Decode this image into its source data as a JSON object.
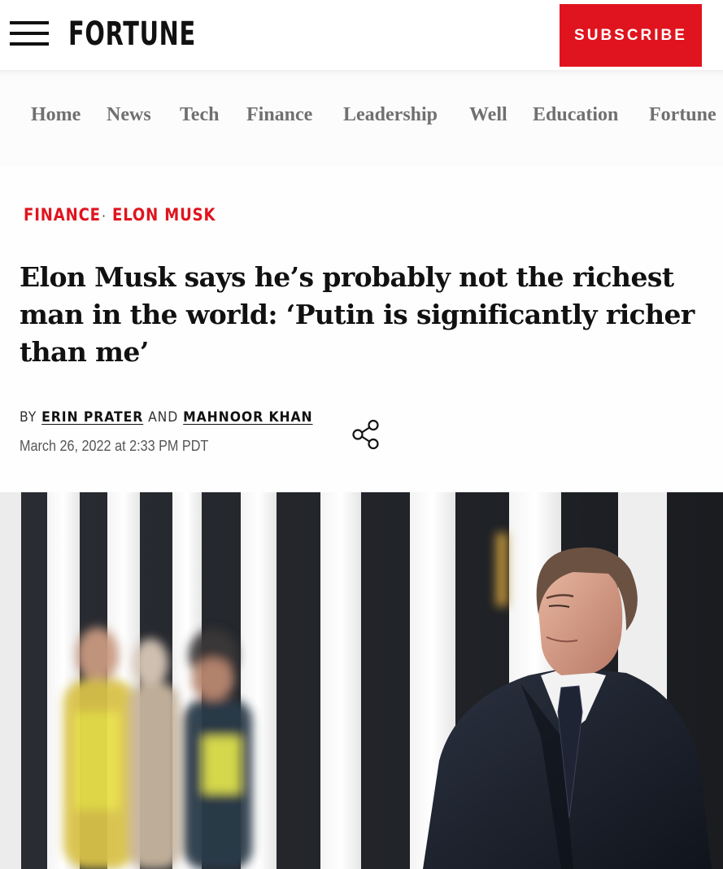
{
  "header": {
    "logo_text": "FORTUNE",
    "subscribe_label": "SUBSCRIBE",
    "brand_color": "#e0141e"
  },
  "nav": {
    "items": [
      "Home",
      "News",
      "Tech",
      "Finance",
      "Leadership",
      "Well",
      "Education",
      "Fortune"
    ]
  },
  "article": {
    "categories": [
      "FINANCE",
      "ELON MUSK"
    ],
    "category_separator": "·",
    "headline": "Elon Musk says he’s probably not the richest man in the world: ‘Putin is significantly richer than me’",
    "byline": {
      "by": "BY",
      "authors": [
        "ERIN PRATER",
        "MAHNOOR KHAN"
      ],
      "conjunction": "AND"
    },
    "date": "March 26, 2022 at 2:33 PM PDT",
    "share_icon": "share-icon",
    "hero_image": "elon-musk-photo"
  },
  "icons": [
    "hamburger-menu-icon",
    "share-icon"
  ]
}
